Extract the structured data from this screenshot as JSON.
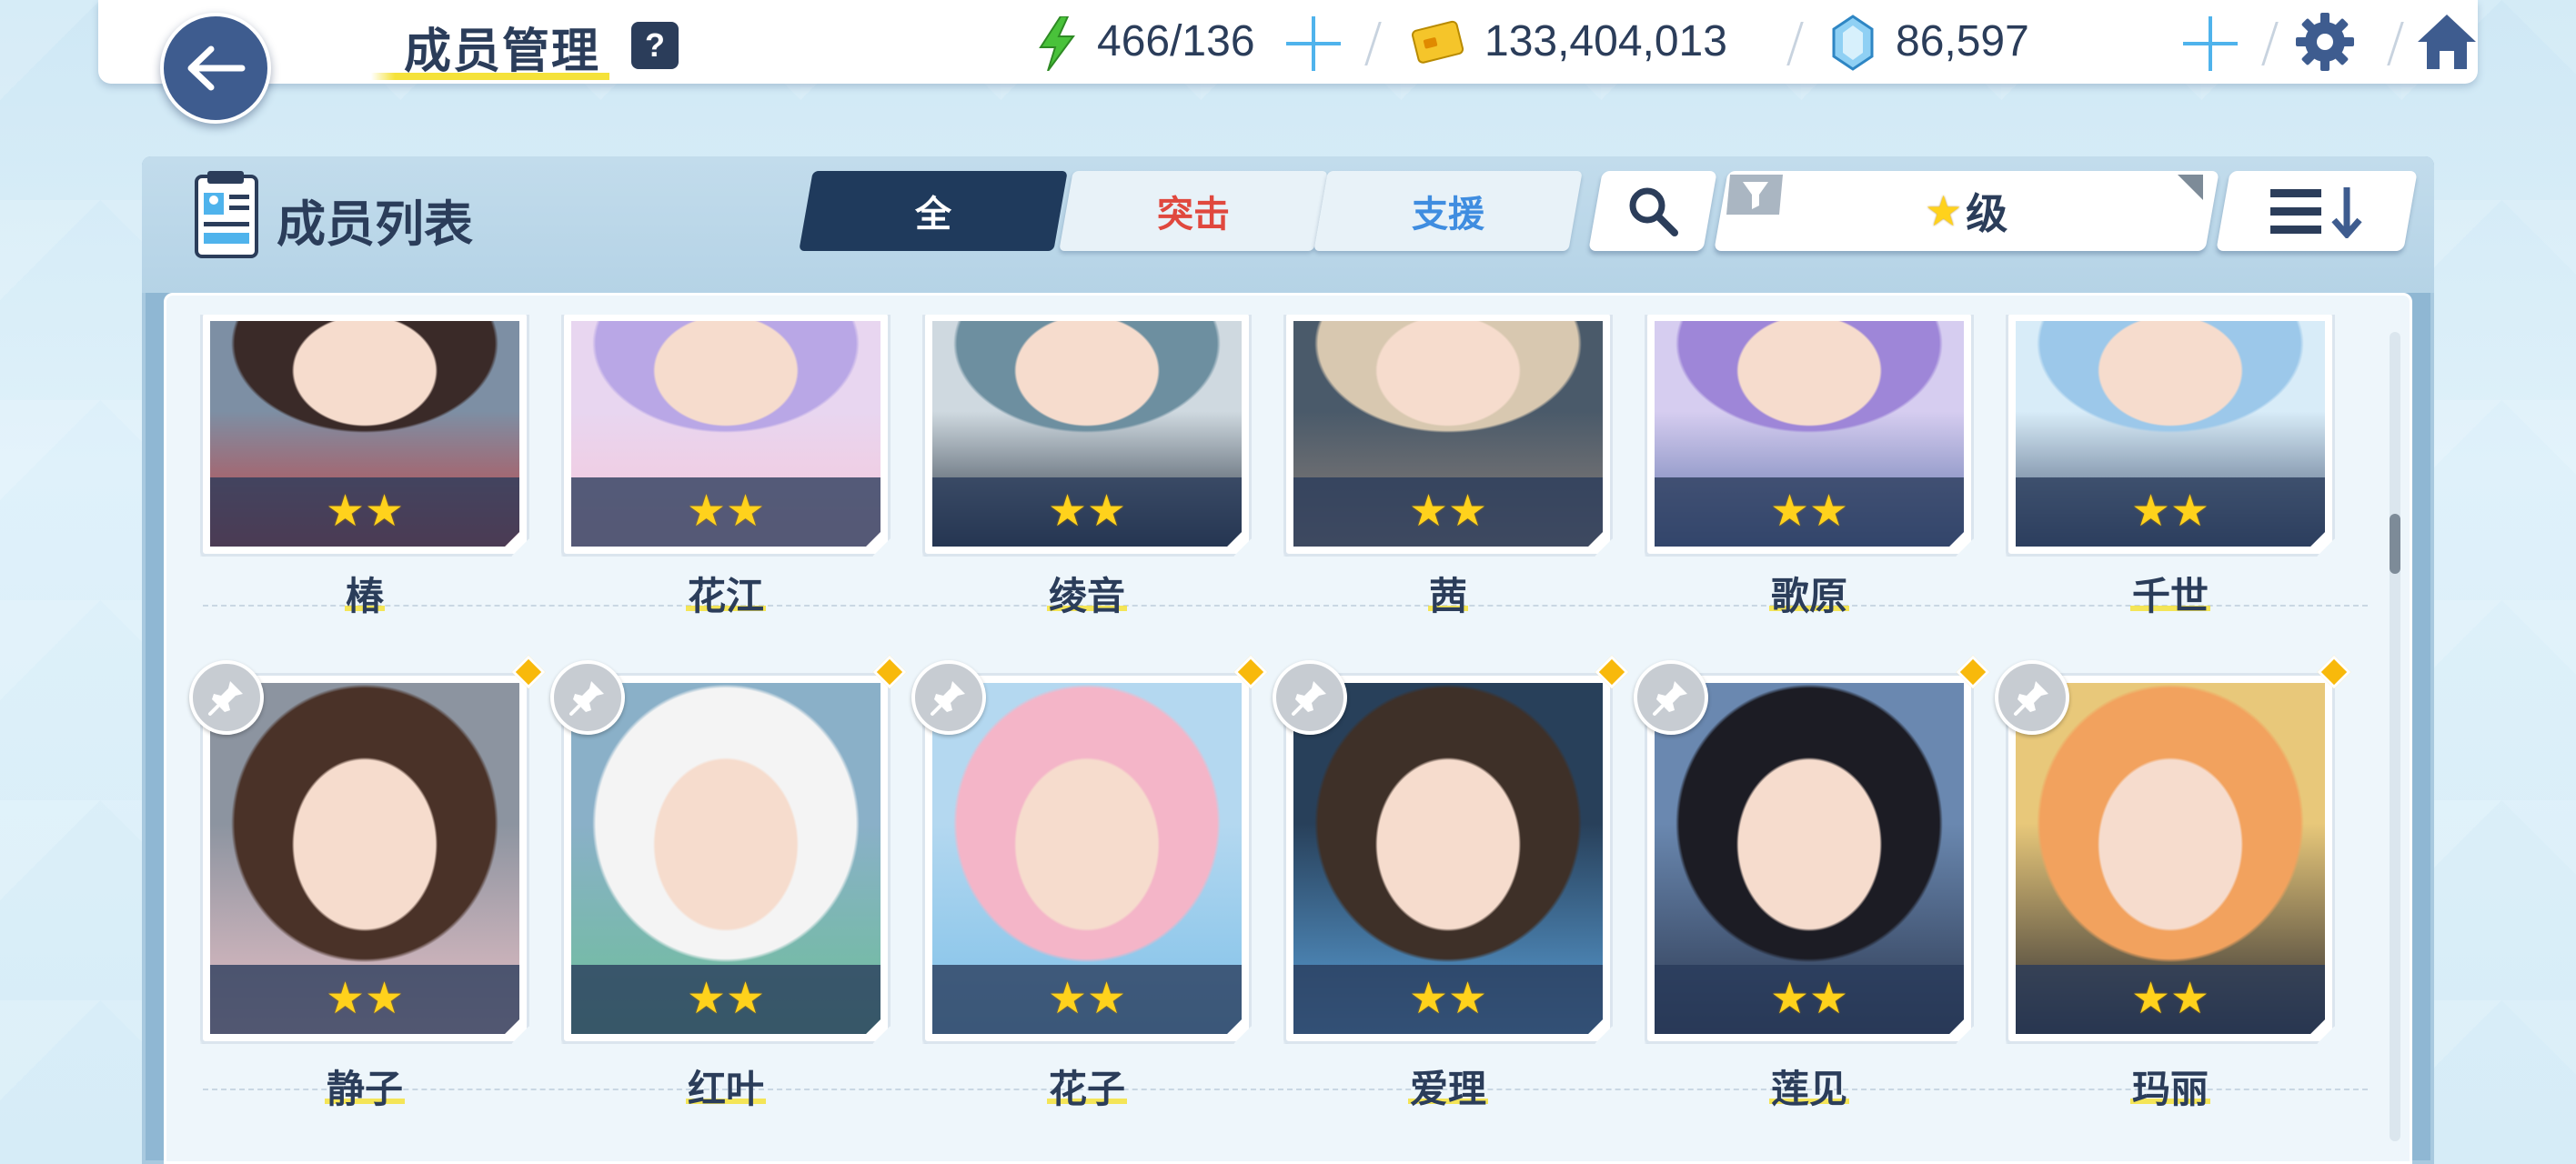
{
  "header": {
    "title": "成员管理",
    "help_label": "?",
    "ap": "466/136",
    "credits": "133,404,013",
    "gems": "86,597"
  },
  "panel": {
    "title": "成员列表",
    "tabs": [
      {
        "label": "全",
        "color": "#ffffff"
      },
      {
        "label": "突击",
        "color": "#e0483e"
      },
      {
        "label": "支援",
        "color": "#3f8de0"
      }
    ],
    "sort_label": "级",
    "sort_star": "★"
  },
  "colors": {
    "accent_blue": "#4fb3ec",
    "dark_navy": "#1f3a5c",
    "highlight_yellow": "#f5e23a",
    "star_yellow": "#ffd21c"
  },
  "members_row1": [
    {
      "name": "椿",
      "stars": "★★"
    },
    {
      "name": "花江",
      "stars": "★★"
    },
    {
      "name": "绫音",
      "stars": "★★"
    },
    {
      "name": "茜",
      "stars": "★★"
    },
    {
      "name": "歌原",
      "stars": "★★"
    },
    {
      "name": "千世",
      "stars": "★★"
    }
  ],
  "members_row2": [
    {
      "name": "静子",
      "stars": "★★"
    },
    {
      "name": "红叶",
      "stars": "★★"
    },
    {
      "name": "花子",
      "stars": "★★"
    },
    {
      "name": "爱理",
      "stars": "★★"
    },
    {
      "name": "莲见",
      "stars": "★★"
    },
    {
      "name": "玛丽",
      "stars": "★★"
    }
  ]
}
